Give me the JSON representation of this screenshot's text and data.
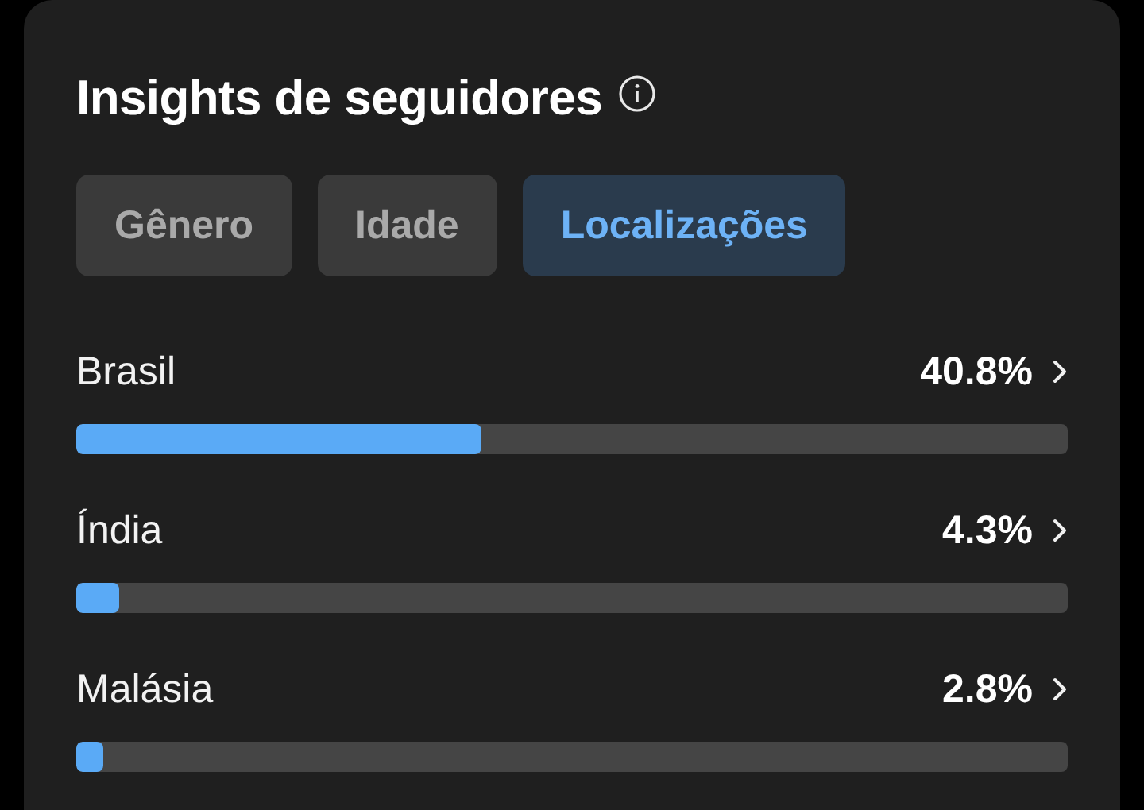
{
  "card": {
    "title": "Insights de seguidores"
  },
  "tabs": [
    {
      "label": "Gênero",
      "selected": false
    },
    {
      "label": "Idade",
      "selected": false
    },
    {
      "label": "Localizações",
      "selected": true
    }
  ],
  "locations": [
    {
      "name": "Brasil",
      "percent": "40.8%",
      "level": 0.408
    },
    {
      "name": "Índia",
      "percent": "4.3%",
      "level": 0.043
    },
    {
      "name": "Malásia",
      "percent": "2.8%",
      "level": 0.028
    }
  ]
}
